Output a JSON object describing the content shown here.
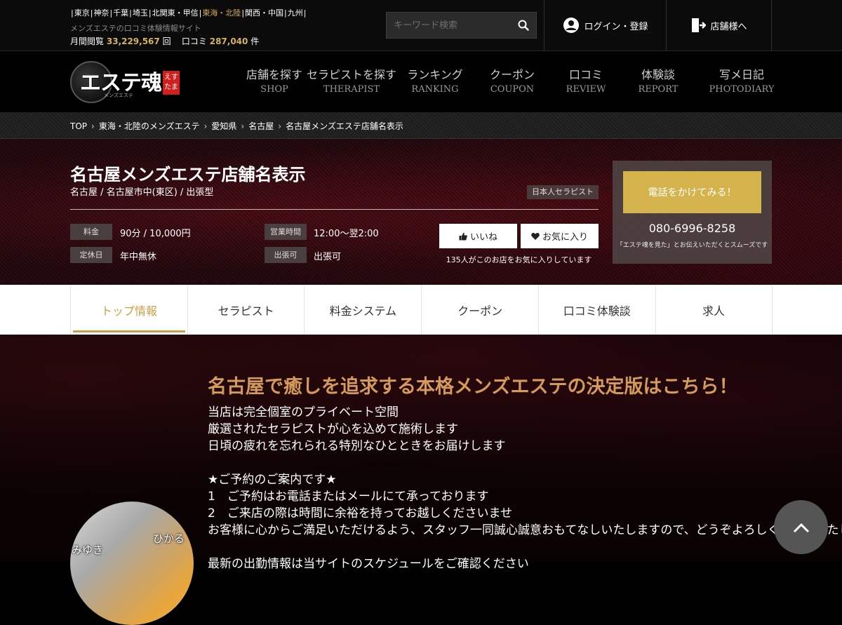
{
  "header": {
    "regions": [
      {
        "label": "東京",
        "active": false
      },
      {
        "label": "神奈",
        "active": false
      },
      {
        "label": "千葉",
        "active": false
      },
      {
        "label": "埼玉",
        "active": false
      },
      {
        "label": "北関東・甲信",
        "active": false
      },
      {
        "label": "東海・北陸",
        "active": true
      },
      {
        "label": "関西・中国",
        "active": false
      },
      {
        "label": "九州",
        "active": false
      }
    ],
    "tagline": "メンズエステの口コミ体験情報サイト",
    "stats": {
      "views_label": "月間閲覧",
      "views_value": "33,229,567",
      "views_unit": "回",
      "reviews_label": "口コミ",
      "reviews_value": "287,040",
      "reviews_unit": "件"
    },
    "search_placeholder": "キーワード検索",
    "login_label": "ログイン・登録",
    "register_label": "店舗様へ"
  },
  "logo": {
    "main": "エステ魂",
    "badge": "えすたま",
    "sub": "メンズエステ"
  },
  "nav": [
    {
      "jp": "店舗を探す",
      "en": "SHOP"
    },
    {
      "jp": "セラピストを探す",
      "en": "THERAPIST"
    },
    {
      "jp": "ランキング",
      "en": "RANKING"
    },
    {
      "jp": "クーポン",
      "en": "COUPON"
    },
    {
      "jp": "口コミ",
      "en": "REVIEW"
    },
    {
      "jp": "体験談",
      "en": "REPORT"
    },
    {
      "jp": "写メ日記",
      "en": "PHOTODIARY"
    }
  ],
  "breadcrumb": [
    "TOP",
    "東海・北陸のメンズエステ",
    "愛知県",
    "名古屋",
    "名古屋メンズエステ店舗名表示"
  ],
  "shop": {
    "title": "名古屋メンズエステ店舗名表示",
    "sub": "名古屋 / 名古屋市中(東区) / 出張型",
    "genre_tag": "日本人セラピスト",
    "fields": [
      {
        "label": "料金",
        "value": "90分 / 10,000円"
      },
      {
        "label": "営業時間",
        "value": "12:00～翌2:00"
      },
      {
        "label": "定休日",
        "value": "年中無休"
      },
      {
        "label": "出張可",
        "value": "出張可"
      }
    ],
    "good_label": "いいね",
    "fav_label": "お気に入り",
    "fav_note": "135人がこのお店をお気に入りしています",
    "call_label": "電話をかけてみる！",
    "tel": "080-6996-8258",
    "tel_note": "「エステ魂を見た」とお伝えいただくとスムーズです"
  },
  "tabs": [
    {
      "label": "トップ情報",
      "active": true
    },
    {
      "label": "セラピスト",
      "active": false
    },
    {
      "label": "料金システム",
      "active": false
    },
    {
      "label": "クーポン",
      "active": false
    },
    {
      "label": "口コミ体験談",
      "active": false
    },
    {
      "label": "求人",
      "active": false
    }
  ],
  "content": {
    "catch": "名古屋で癒しを追求する本格メンズエステの決定版はこちら！",
    "lines": [
      "当店は完全個室のプライベート空間",
      "厳選されたセラピストが心を込めて施術します",
      "日頃の疲れを忘れられる特別なひとときをお届けします",
      "",
      "★ご予約のご案内です★",
      "1　ご予約はお電話またはメールにて承っております",
      "2　ご来店の際は時間に余裕を持ってお越しくださいませ",
      "お客様に心からご満足いただけるよう、スタッフ一同誠心誠意おもてなしいたしますので、どうぞよろしくお願いいたします",
      "",
      "最新の出勤情報は当サイトのスケジュールをご確認ください"
    ],
    "avatar_names": [
      "みゆき",
      "ひかる"
    ]
  }
}
